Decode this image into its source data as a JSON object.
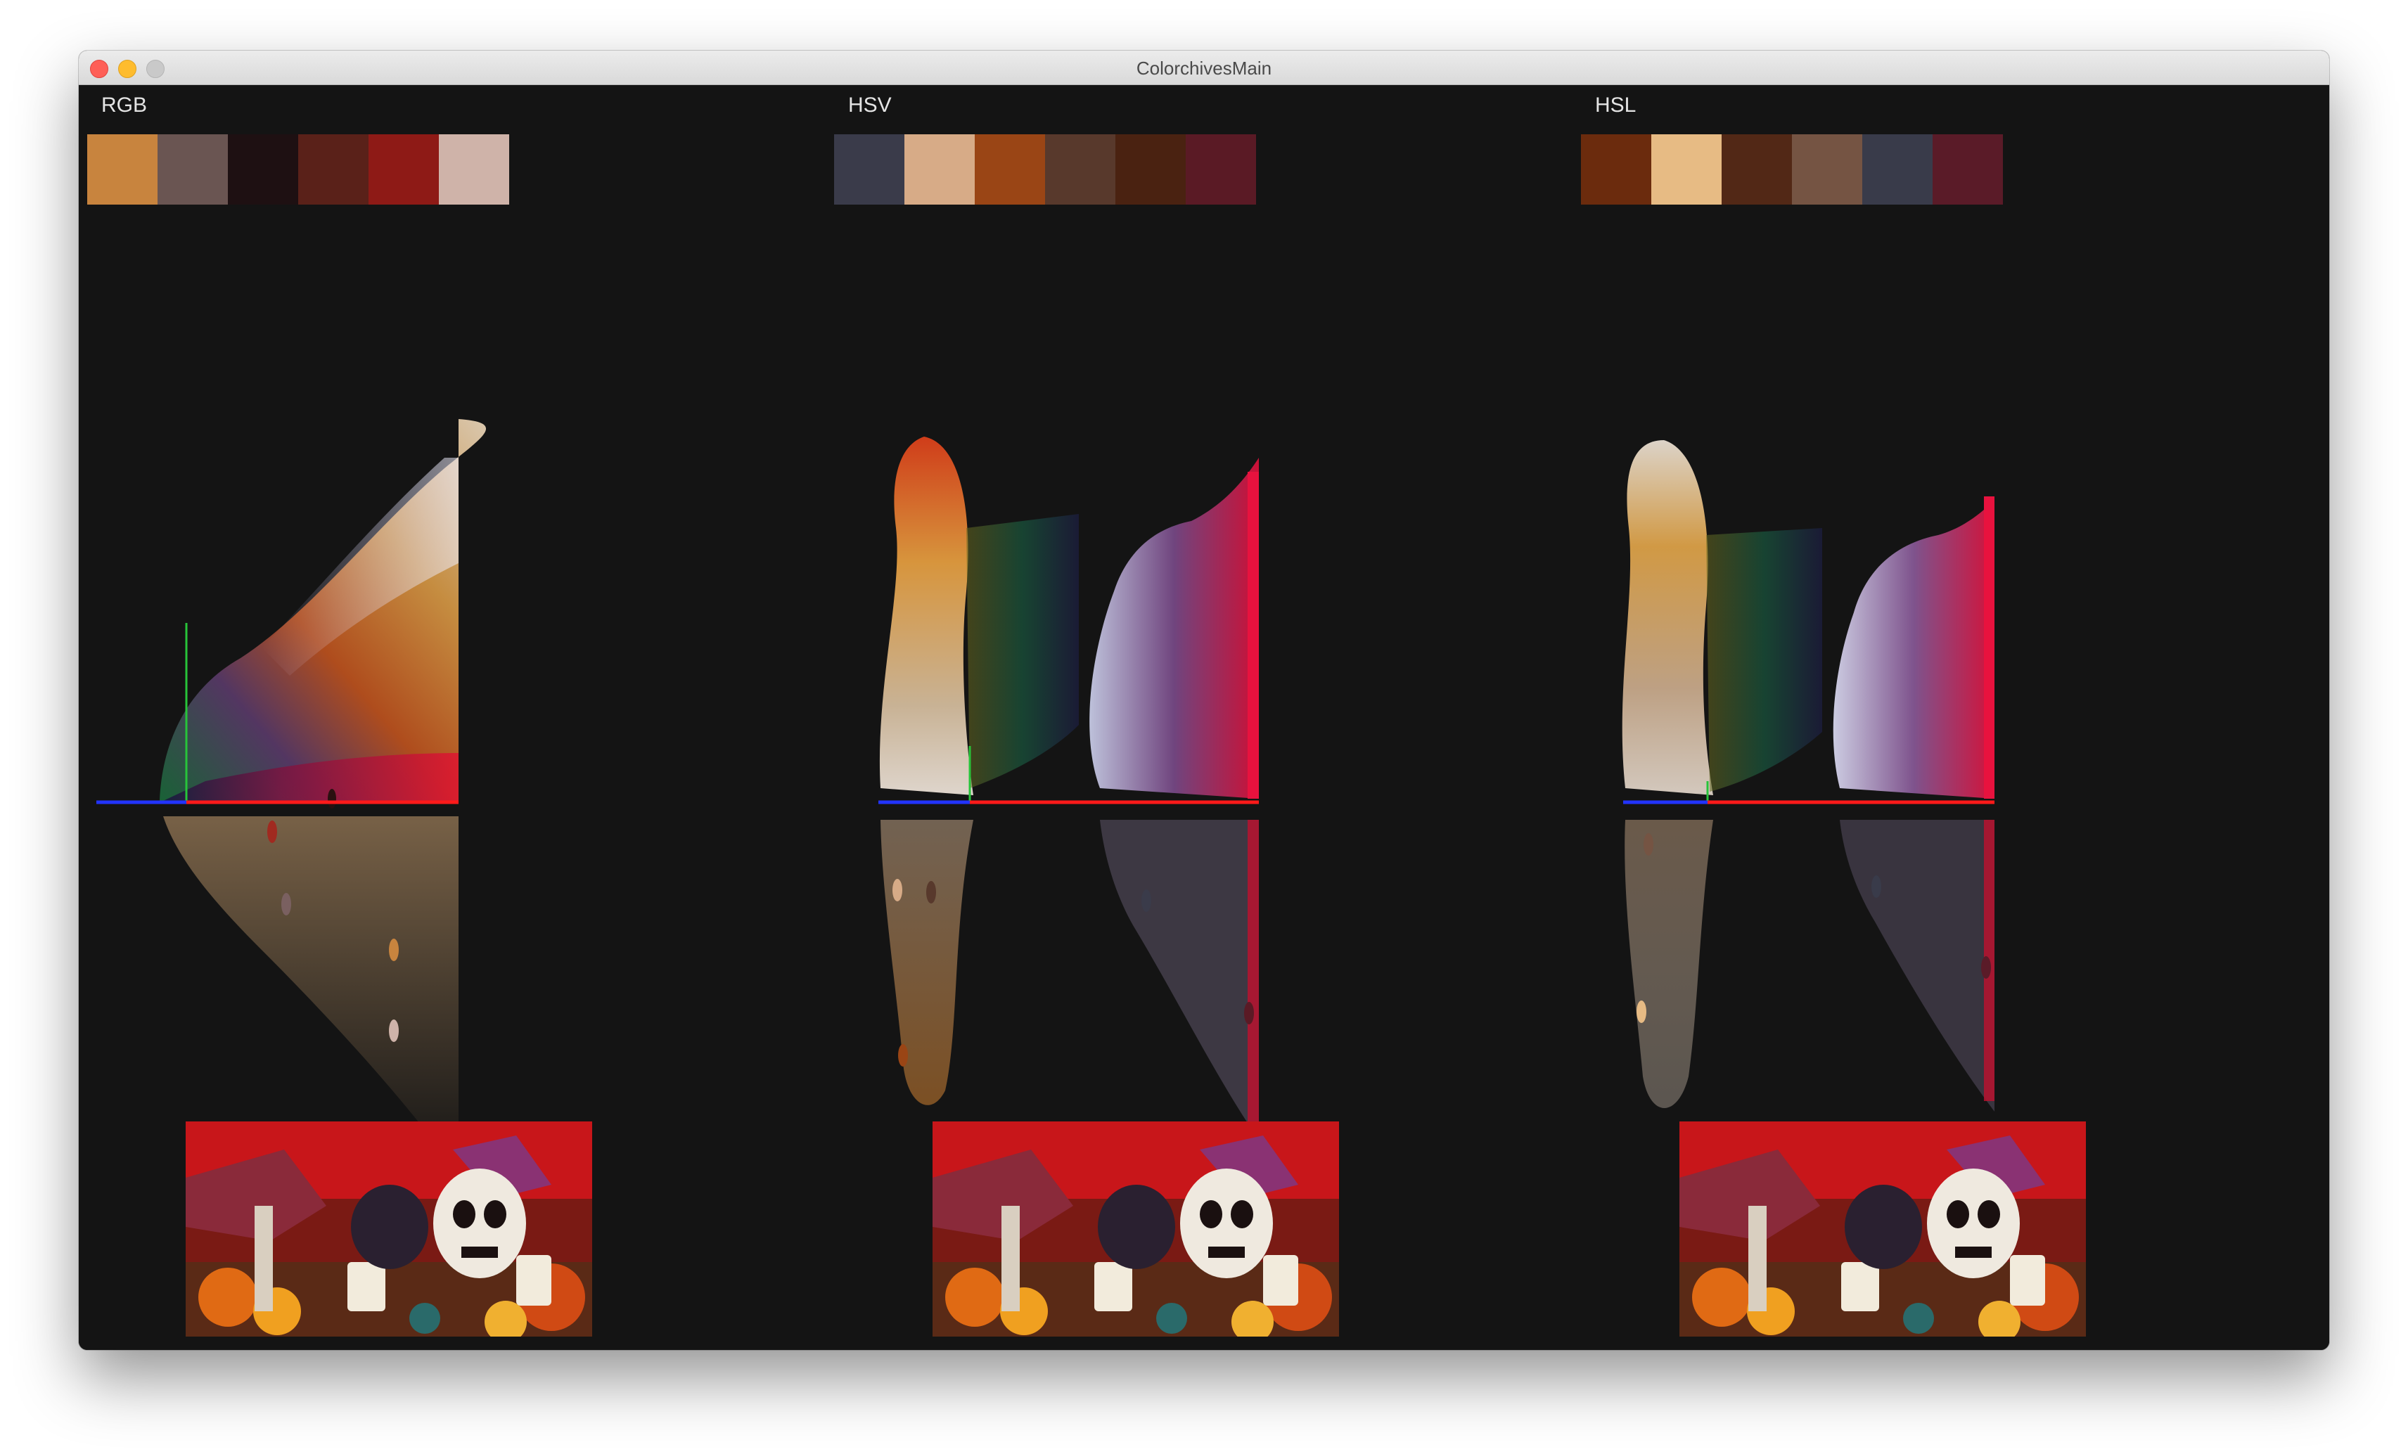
{
  "window": {
    "title": "ColorchivesMain"
  },
  "panels": [
    {
      "label": "RGB",
      "swatches": [
        "#c8843e",
        "#6a5552",
        "#1e1012",
        "#5a2119",
        "#8e1a16",
        "#cfb3a9"
      ]
    },
    {
      "label": "HSV",
      "swatches": [
        "#3a3b4a",
        "#d7ab87",
        "#9a4515",
        "#58392c",
        "#4a2211",
        "#5a1a25"
      ]
    },
    {
      "label": "HSL",
      "swatches": [
        "#6b2b0d",
        "#e7bb84",
        "#522816",
        "#755443",
        "#393b4a",
        "#5a1b28"
      ]
    }
  ],
  "colors": {
    "background": "#141414",
    "axis_red": "#ff1a1a",
    "axis_green": "#27c43a",
    "axis_blue": "#2233ff"
  }
}
